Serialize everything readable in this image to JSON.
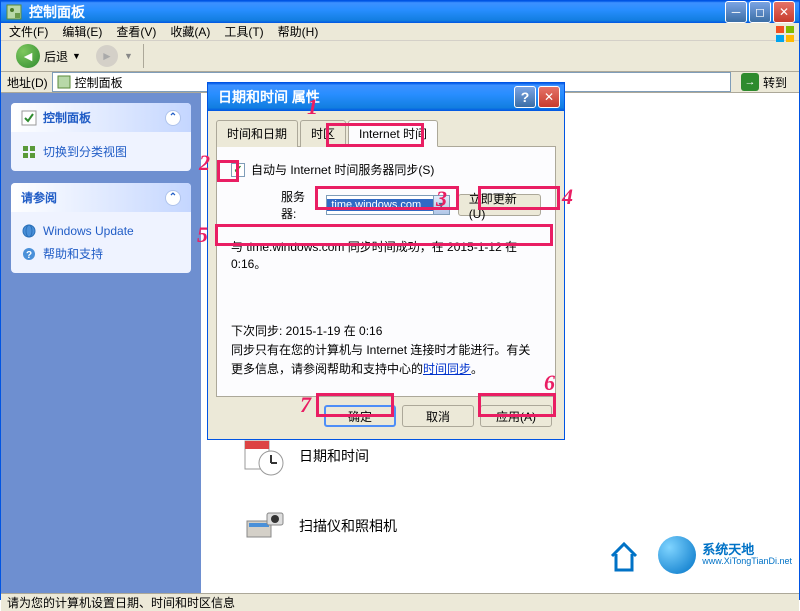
{
  "main_window": {
    "title": "控制面板",
    "menu": {
      "file": "文件(F)",
      "edit": "编辑(E)",
      "view": "查看(V)",
      "favorites": "收藏(A)",
      "tools": "工具(T)",
      "help": "帮助(H)"
    },
    "toolbar": {
      "back": "后退"
    },
    "addressbar": {
      "label": "地址(D)",
      "value": "控制面板",
      "go": "转到"
    },
    "statusbar": "请为您的计算机设置日期、时间和时区信息"
  },
  "sidebar": {
    "panel1": {
      "title": "控制面板",
      "switch_view": "切换到分类视图"
    },
    "panel2": {
      "title": "请参阅",
      "windows_update": "Windows Update",
      "help_support": "帮助和支持"
    }
  },
  "categories": {
    "datetime": "日期和时间",
    "scanners": "扫描仪和照相机"
  },
  "dialog": {
    "title": "日期和时间 属性",
    "tabs": {
      "datetime": "时间和日期",
      "timezone": "时区",
      "internet": "Internet 时间"
    },
    "sync_checkbox": "自动与 Internet 时间服务器同步(S)",
    "server_label": "服务器:",
    "server_value": "time.windows.com",
    "update_now": "立即更新(U)",
    "sync_status": "与 time.windows.com 同步时间成功，在 2015-1-12 在 0:16。",
    "next_sync": "下次同步: 2015-1-19 在 0:16",
    "info_text_1": "同步只有在您的计算机与 Internet 连接时才能进行。有关更多信息，请参阅帮助和支持中心的",
    "info_link": "时间同步",
    "info_text_2": "。",
    "buttons": {
      "ok": "确定",
      "cancel": "取消",
      "apply": "应用(A)"
    }
  },
  "annotations": {
    "1": "1",
    "2": "2",
    "3": "3",
    "4": "4",
    "5": "5",
    "6": "6",
    "7": "7"
  },
  "watermark": {
    "cn": "系统天地",
    "en": "www.XiTongTianDi.net"
  }
}
